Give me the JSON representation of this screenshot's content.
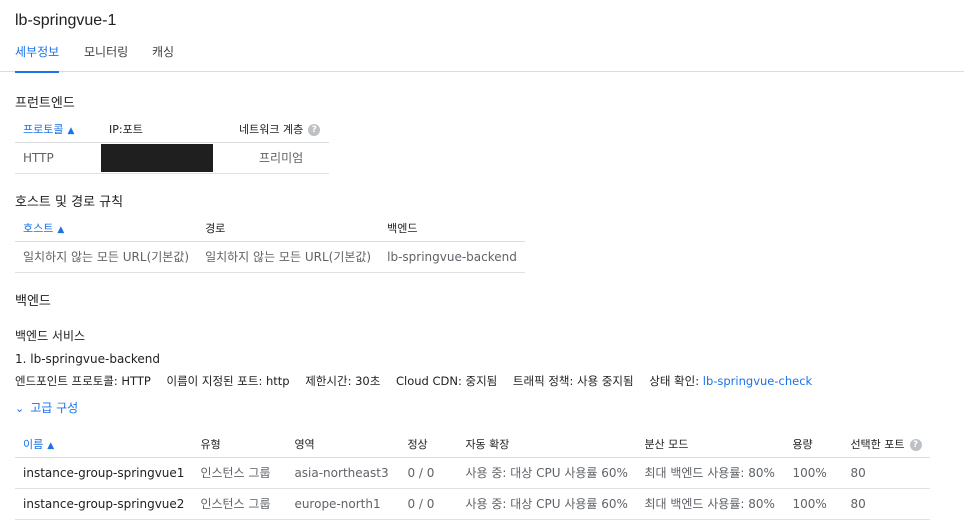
{
  "title": "lb-springvue-1",
  "tabs": [
    "세부정보",
    "모니터링",
    "캐싱"
  ],
  "frontend": {
    "heading": "프런트엔드",
    "headers": [
      "프로토콜",
      "IP:포트",
      "네트워크 계층"
    ],
    "rows": [
      {
        "protocol": "HTTP",
        "tier": "프리미엄"
      }
    ]
  },
  "host_rules": {
    "heading": "호스트 및 경로 규칙",
    "headers": [
      "호스트",
      "경로",
      "백엔드"
    ],
    "rows": [
      {
        "host": "일치하지 않는 모든 URL(기본값)",
        "path": "일치하지 않는 모든 URL(기본값)",
        "backend": "lb-springvue-backend"
      }
    ]
  },
  "backend": {
    "heading": "백엔드",
    "services_label": "백엔드 서비스",
    "service_name": "1. lb-springvue-backend",
    "details": [
      {
        "label": "엔드포인트 프로토콜: ",
        "value": "HTTP"
      },
      {
        "label": "이름이 지정된 포트: ",
        "value": "http"
      },
      {
        "label": "제한시간: ",
        "value": "30초"
      },
      {
        "label": "Cloud CDN: ",
        "value": "중지됨"
      },
      {
        "label": "트래픽 정책: ",
        "value": "사용 중지됨"
      }
    ],
    "health_check_label": "상태 확인: ",
    "health_check_link": "lb-springvue-check",
    "advanced_label": "고급 구성",
    "table_headers": [
      "이름",
      "유형",
      "영역",
      "정상",
      "자동 확장",
      "분산 모드",
      "용량",
      "선택한 포트"
    ],
    "rows": [
      {
        "name": "instance-group-springvue1",
        "type": "인스턴스 그룹",
        "zone": "asia-northeast3",
        "healthy": "0 / 0",
        "autoscale": "사용 중: 대상 CPU 사용률 60%",
        "mode": "최대 백엔드 사용률: 80%",
        "capacity": "100%",
        "port": "80"
      },
      {
        "name": "instance-group-springvue2",
        "type": "인스턴스 그룹",
        "zone": "europe-north1",
        "healthy": "0 / 0",
        "autoscale": "사용 중: 대상 CPU 사용률 60%",
        "mode": "최대 백엔드 사용률: 80%",
        "capacity": "100%",
        "port": "80"
      }
    ]
  },
  "colors": {
    "accent": "#1a73e8",
    "text": "#202124",
    "muted": "#5f6368",
    "divider": "#dadce0"
  }
}
